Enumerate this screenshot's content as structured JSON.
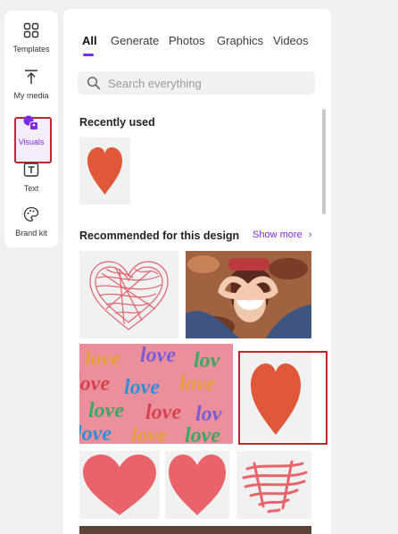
{
  "rail": {
    "items": [
      {
        "label": "Templates",
        "icon": "templates-icon"
      },
      {
        "label": "My media",
        "icon": "upload-icon"
      },
      {
        "label": "Visuals",
        "icon": "visuals-icon",
        "active": true
      },
      {
        "label": "Text",
        "icon": "text-icon"
      },
      {
        "label": "Brand kit",
        "icon": "brand-kit-icon"
      }
    ]
  },
  "tabs": [
    {
      "label": "All",
      "active": true
    },
    {
      "label": "Generate"
    },
    {
      "label": "Photos"
    },
    {
      "label": "Graphics"
    },
    {
      "label": "Videos"
    }
  ],
  "search": {
    "placeholder": "Search everything"
  },
  "recently_used": {
    "title": "Recently used"
  },
  "recommended": {
    "title": "Recommended for this design",
    "show_more": "Show more"
  },
  "colors": {
    "accent": "#7d2ae8",
    "highlight": "#c0272d",
    "heart_orange": "#e0583a",
    "heart_pink": "#e9636b"
  }
}
